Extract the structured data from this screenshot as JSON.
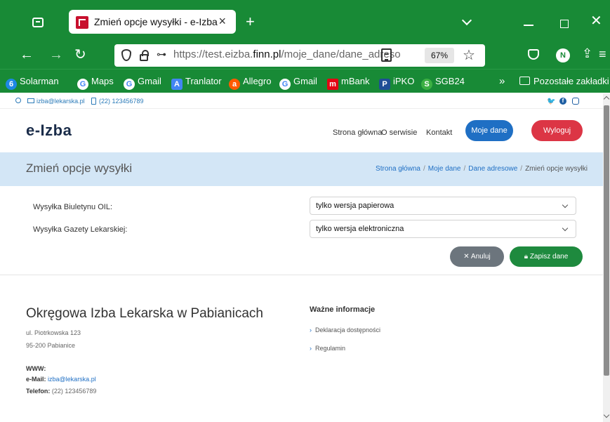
{
  "browser": {
    "tab_title": "Zmień opcje wysyłki - e-Izba",
    "tab_close": "×",
    "new_tab": "+",
    "url_prefix": "https://test.eizba.",
    "url_domain": "finn.pl",
    "url_path": "/moje_dane/dane_adreso",
    "zoom": "67%",
    "account_initial": "N",
    "bookmarks": [
      {
        "label": "Solarman",
        "icon": "solarman-icon",
        "color": "#1e88e5"
      },
      {
        "label": "Maps",
        "icon": "google-icon",
        "color": "#ffffff"
      },
      {
        "label": "Gmail",
        "icon": "google-icon",
        "color": "#ffffff"
      },
      {
        "label": "Tranlator",
        "icon": "translate-icon",
        "color": "#4285f4"
      },
      {
        "label": "Allegro",
        "icon": "allegro-icon",
        "color": "#ff5a00"
      },
      {
        "label": "Gmail",
        "icon": "google-icon",
        "color": "#ffffff"
      },
      {
        "label": "mBank",
        "icon": "mbank-icon",
        "color": "#e30613"
      },
      {
        "label": "iPKO",
        "icon": "pko-icon",
        "color": "#1f4e96"
      },
      {
        "label": "SGB24",
        "icon": "sgb-icon",
        "color": "#3cb043"
      }
    ],
    "bookmarks_other": "Pozostałe zakładki"
  },
  "site": {
    "topbar_email": "izba@lekarska.pl",
    "topbar_phone": "(22) 123456789",
    "logo": "e-Izba",
    "nav": {
      "home": "Strona główna",
      "about": "O serwisie",
      "contact": "Kontakt",
      "my_data": "Moje dane",
      "logout": "Wyloguj"
    }
  },
  "page": {
    "title": "Zmień opcje wysyłki",
    "breadcrumb": [
      "Strona główna",
      "Moje dane",
      "Dane adresowe",
      "Zmień opcje wysyłki"
    ],
    "form": {
      "bulletin_label": "Wysyłka Biuletynu OIL:",
      "bulletin_value": "tylko wersja papierowa",
      "gazette_label": "Wysyłka Gazety Lekarskiej:",
      "gazette_value": "tylko wersja elektroniczna",
      "cancel": "✕ Anuluj",
      "save": "Zapisz dane"
    }
  },
  "footer": {
    "org_name": "Okręgowa Izba Lekarska w Pabianicach",
    "address_line1": "ul. Piotrkowska 123",
    "address_line2": "95-200 Pabianice",
    "www_label": "WWW:",
    "email_label": "e-Mail:",
    "email_value": "izba@lekarska.pl",
    "phone_label": "Telefon:",
    "phone_value": "(22) 123456789",
    "info_title": "Ważne informacje",
    "info_links": [
      "Deklaracja dostępności",
      "Regulamin"
    ]
  }
}
